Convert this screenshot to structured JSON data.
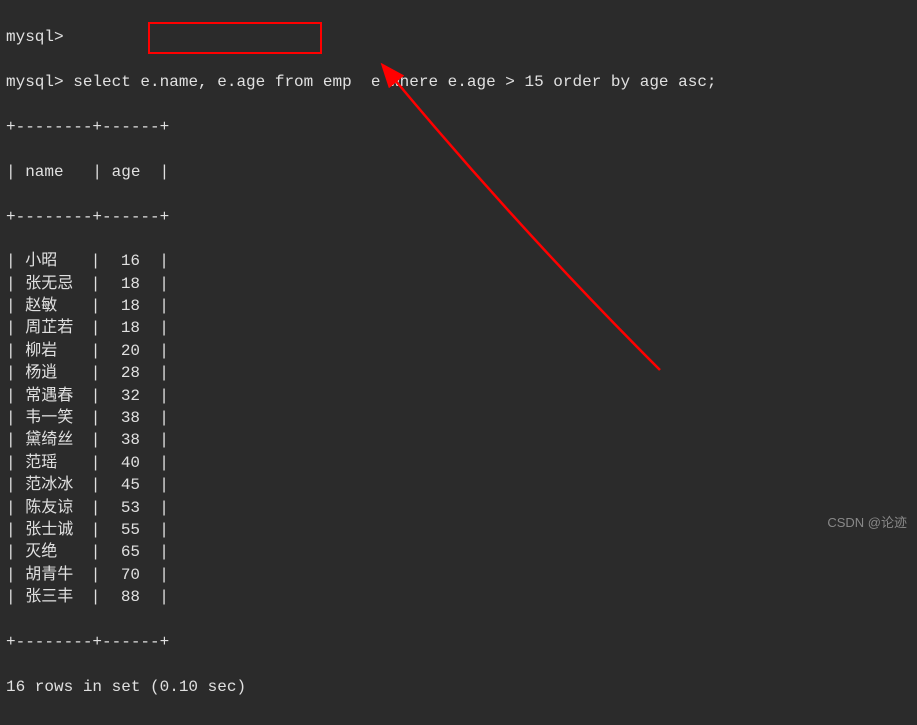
{
  "prompt_empty": "mysql>",
  "prompt": "mysql>",
  "query": "select e.name, e.age from emp  e where e.age > 15 order by age asc;",
  "table": {
    "border": "+--------+------+",
    "header_line": "| name   | age  |",
    "columns": [
      "name",
      "age"
    ],
    "rows": [
      {
        "name": "小昭",
        "age": 16
      },
      {
        "name": "张无忌",
        "age": 18
      },
      {
        "name": "赵敏",
        "age": 18
      },
      {
        "name": "周芷若",
        "age": 18
      },
      {
        "name": "柳岩",
        "age": 20
      },
      {
        "name": "杨逍",
        "age": 28
      },
      {
        "name": "常遇春",
        "age": 32
      },
      {
        "name": "韦一笑",
        "age": 38
      },
      {
        "name": "黛绮丝",
        "age": 38
      },
      {
        "name": "范瑶",
        "age": 40
      },
      {
        "name": "范冰冰",
        "age": 45
      },
      {
        "name": "陈友谅",
        "age": 53
      },
      {
        "name": "张士诚",
        "age": 55
      },
      {
        "name": "灭绝",
        "age": 65
      },
      {
        "name": "胡青牛",
        "age": 70
      },
      {
        "name": "张三丰",
        "age": 88
      }
    ]
  },
  "footer": "16 rows in set (0.10 sec)",
  "watermark": "CSDN @论迹",
  "annotation": {
    "box_color": "#ff0000",
    "arrow_color": "#ff0000"
  }
}
